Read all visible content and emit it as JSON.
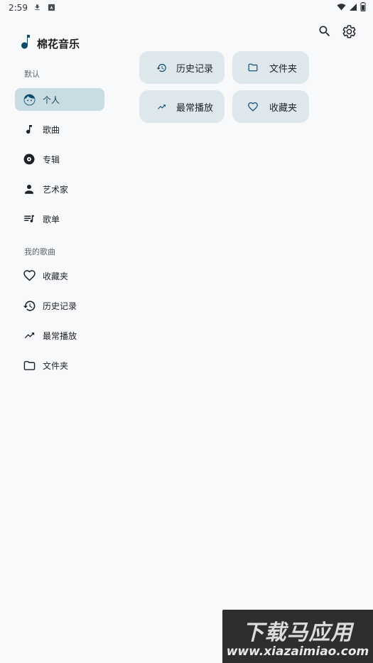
{
  "statusbar": {
    "time": "2:59"
  },
  "app": {
    "title": "棉花音乐"
  },
  "sections": {
    "default": "默认",
    "my_songs": "我的歌曲"
  },
  "nav": {
    "default": [
      {
        "label": "个人",
        "icon": "face-icon",
        "active": true
      },
      {
        "label": "歌曲",
        "icon": "music-note-icon"
      },
      {
        "label": "专辑",
        "icon": "album-icon"
      },
      {
        "label": "艺术家",
        "icon": "person-icon"
      },
      {
        "label": "歌单",
        "icon": "playlist-icon"
      }
    ],
    "my_songs": [
      {
        "label": "收藏夹",
        "icon": "heart-icon"
      },
      {
        "label": "历史记录",
        "icon": "history-icon"
      },
      {
        "label": "最常播放",
        "icon": "trending-up-icon"
      },
      {
        "label": "文件夹",
        "icon": "folder-icon"
      }
    ]
  },
  "quick": [
    {
      "label": "历史记录",
      "icon": "history-icon"
    },
    {
      "label": "文件夹",
      "icon": "folder-icon"
    },
    {
      "label": "最常播放",
      "icon": "trending-up-icon"
    },
    {
      "label": "收藏夹",
      "icon": "heart-icon"
    }
  ],
  "watermark": {
    "line1": "下载马应用",
    "line2": "www.xiazaimiao.com"
  },
  "colors": {
    "accent": "#0f4c6a",
    "active_bg": "#c9dce3",
    "card_bg": "#dde7ec",
    "background": "#f8f9fa"
  }
}
